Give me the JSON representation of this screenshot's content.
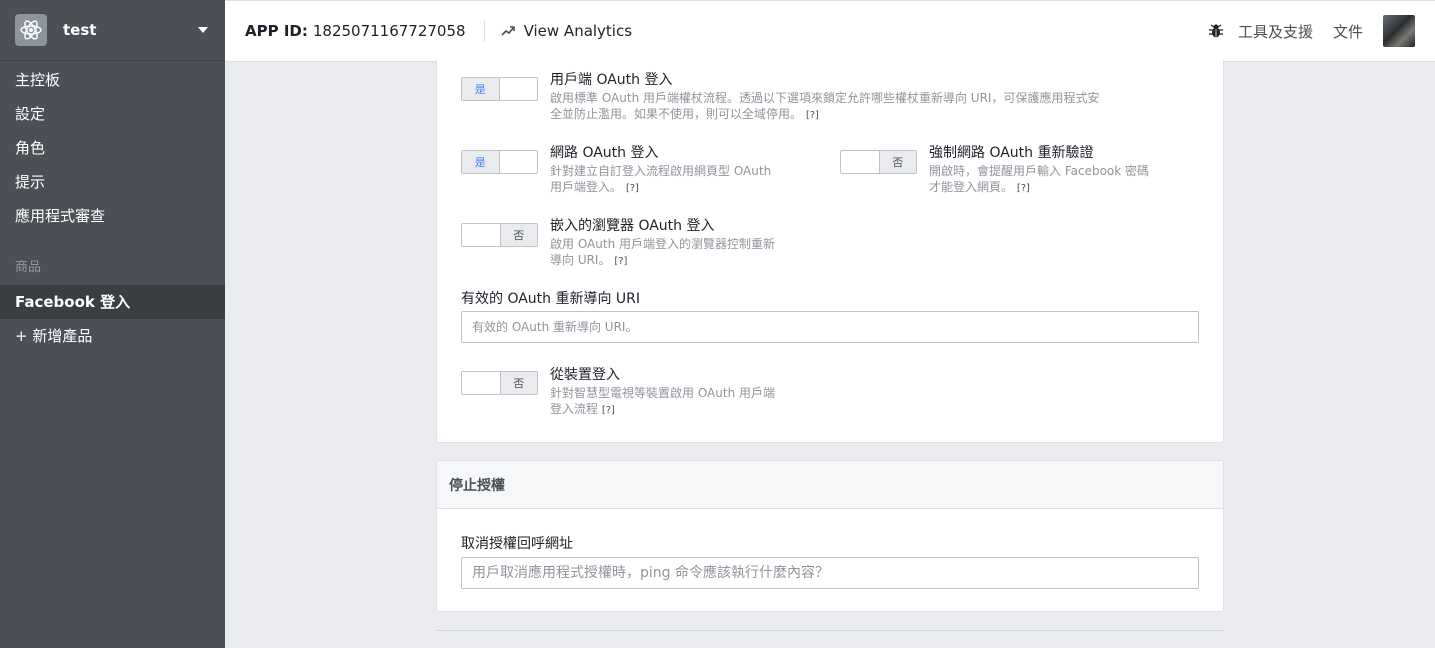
{
  "app": {
    "name": "test",
    "icon": "atom-icon"
  },
  "sidebar": {
    "items": [
      {
        "label": "主控板"
      },
      {
        "label": "設定"
      },
      {
        "label": "角色"
      },
      {
        "label": "提示"
      },
      {
        "label": "應用程式審查"
      }
    ],
    "section_label": "商品",
    "products": [
      {
        "label": "Facebook 登入",
        "active": true
      },
      {
        "label": "+ 新增產品"
      }
    ]
  },
  "topbar": {
    "app_id_label": "APP ID:",
    "app_id": "1825071167727058",
    "analytics_label": "View Analytics",
    "analytics_icon": "trending-up-icon",
    "bug_icon": "bug-icon",
    "tools_label": "工具及支援",
    "docs_label": "文件"
  },
  "settings": {
    "client_oauth": {
      "toggle_text": "是",
      "on": true,
      "title": "用戶端 OAuth 登入",
      "desc1": "啟用標準 OAuth 用戶端權杖流程。透過以下選項來鎖定允許哪些權杖重新導向 URI，可保護應用程式安",
      "desc2": "全並防止濫用。如果不使用，則可以全域停用。",
      "help": "[?]"
    },
    "web_oauth": {
      "toggle_text": "是",
      "on": true,
      "title": "網路 OAuth 登入",
      "desc1": "針對建立自訂登入流程啟用網頁型 OAuth",
      "desc2": "用戶端登入。",
      "help": "[?]"
    },
    "force_reauth": {
      "toggle_text": "否",
      "on": false,
      "title": "強制網路 OAuth 重新驗證",
      "desc1": "開啟時，會提醒用戶輸入 Facebook 密碼",
      "desc2": "才能登入網頁。",
      "help": "[?]"
    },
    "embedded_browser": {
      "toggle_text": "否",
      "on": false,
      "title": "嵌入的瀏覽器 OAuth 登入",
      "desc1": "啟用 OAuth 用戶端登入的瀏覽器控制重新",
      "desc2": "導向 URI。",
      "help": "[?]"
    },
    "redirect_uri": {
      "label": "有效的 OAuth 重新導向 URI",
      "placeholder": "有效的 OAuth 重新導向 URI。"
    },
    "device_login": {
      "toggle_text": "否",
      "on": false,
      "title": "從裝置登入",
      "desc1": "針對智慧型電視等裝置啟用 OAuth 用戶端",
      "desc2": "登入流程",
      "help": "[?]"
    }
  },
  "deauthorize": {
    "header": "停止授權",
    "label": "取消授權回呼網址",
    "placeholder": "用戶取消應用程式授權時，ping 命令應該執行什麼內容？"
  }
}
